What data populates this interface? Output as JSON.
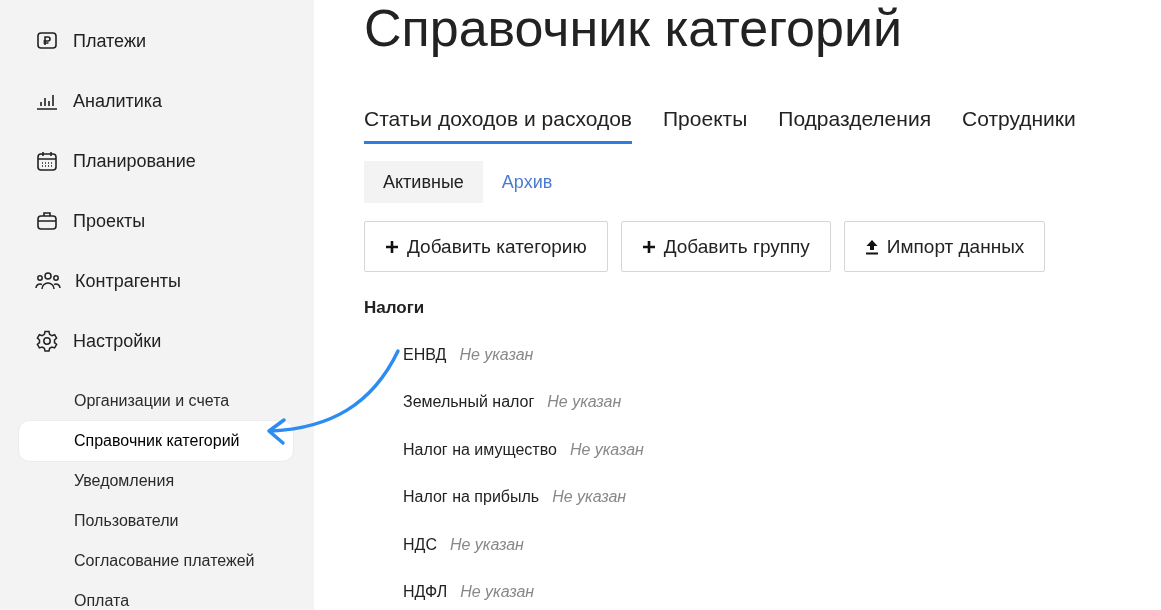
{
  "sidebar": {
    "items": [
      {
        "label": "Платежи"
      },
      {
        "label": "Аналитика"
      },
      {
        "label": "Планирование"
      },
      {
        "label": "Проекты"
      },
      {
        "label": "Контрагенты"
      },
      {
        "label": "Настройки",
        "children": [
          {
            "label": "Организации и счета",
            "selected": false
          },
          {
            "label": "Справочник категорий",
            "selected": true
          },
          {
            "label": "Уведомления",
            "selected": false
          },
          {
            "label": "Пользователи",
            "selected": false
          },
          {
            "label": "Согласование платежей",
            "selected": false
          },
          {
            "label": "Оплата",
            "selected": false
          }
        ]
      }
    ]
  },
  "page": {
    "title": "Справочник категорий",
    "tabs": [
      {
        "label": "Статьи доходов и расходов",
        "selected": true
      },
      {
        "label": "Проекты",
        "selected": false
      },
      {
        "label": "Подразделения",
        "selected": false
      },
      {
        "label": "Сотрудники",
        "selected": false
      }
    ],
    "subtabs": [
      {
        "label": "Активные",
        "selected": true
      },
      {
        "label": "Архив",
        "selected": false
      }
    ],
    "buttons": [
      {
        "label": "Добавить категорию",
        "kind": "add"
      },
      {
        "label": "Добавить группу",
        "kind": "add"
      },
      {
        "label": "Импорт данных",
        "kind": "upload"
      }
    ],
    "groups": [
      {
        "name": "Налоги",
        "items": [
          {
            "name": "ЕНВД",
            "note": "Не указан"
          },
          {
            "name": "Земельный налог",
            "note": "Не указан"
          },
          {
            "name": "Налог на имущество",
            "note": "Не указан"
          },
          {
            "name": "Налог на прибыль",
            "note": "Не указан"
          },
          {
            "name": "НДС",
            "note": "Не указан"
          },
          {
            "name": "НДФЛ",
            "note": "Не указан"
          }
        ]
      }
    ]
  }
}
